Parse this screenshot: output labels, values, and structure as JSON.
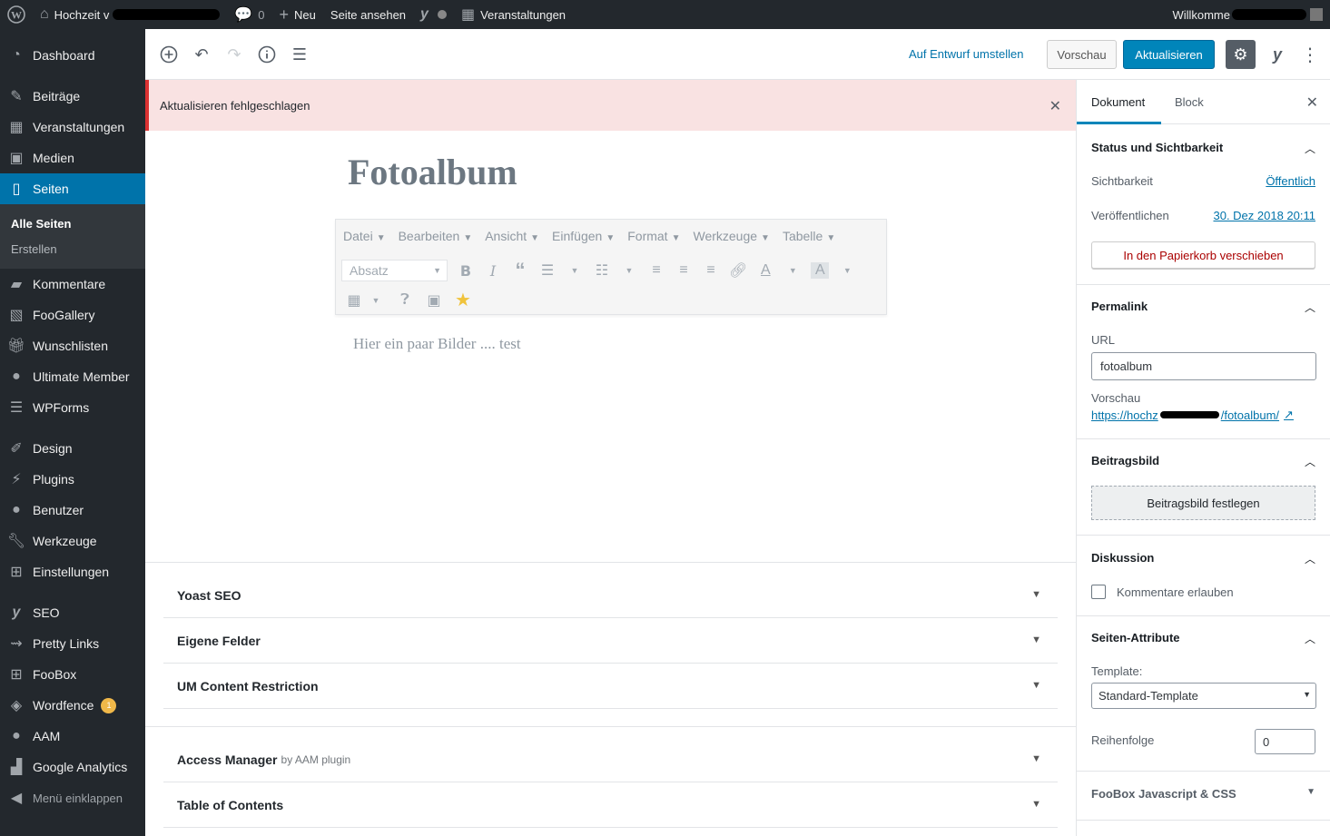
{
  "adminbar": {
    "site_name": "Hochzeit v",
    "comments_count": "0",
    "new_label": "Neu",
    "view_page": "Seite ansehen",
    "events": "Veranstaltungen",
    "greeting": "Willkomme"
  },
  "menu": {
    "items": [
      {
        "label": "Dashboard",
        "icon": "dashboard-icon"
      },
      {
        "label": "Beiträge",
        "icon": "pin-icon"
      },
      {
        "label": "Veranstaltungen",
        "icon": "calendar-icon"
      },
      {
        "label": "Medien",
        "icon": "media-icon"
      },
      {
        "label": "Seiten",
        "icon": "page-icon"
      },
      {
        "label": "Kommentare",
        "icon": "comment-icon"
      },
      {
        "label": "FooGallery",
        "icon": "gallery-icon"
      },
      {
        "label": "Wunschlisten",
        "icon": "gift-icon"
      },
      {
        "label": "Ultimate Member",
        "icon": "user-icon"
      },
      {
        "label": "WPForms",
        "icon": "form-icon"
      },
      {
        "label": "Design",
        "icon": "brush-icon"
      },
      {
        "label": "Plugins",
        "icon": "plugin-icon"
      },
      {
        "label": "Benutzer",
        "icon": "users-icon"
      },
      {
        "label": "Werkzeuge",
        "icon": "wrench-icon"
      },
      {
        "label": "Einstellungen",
        "icon": "settings-icon"
      },
      {
        "label": "SEO",
        "icon": "yoast-icon"
      },
      {
        "label": "Pretty Links",
        "icon": "link-icon"
      },
      {
        "label": "FooBox",
        "icon": "grid-icon"
      },
      {
        "label": "Wordfence",
        "icon": "shield-icon",
        "badge": "1"
      },
      {
        "label": "AAM",
        "icon": "lock-user-icon"
      },
      {
        "label": "Google Analytics",
        "icon": "chart-icon"
      }
    ],
    "submenu": [
      "Alle Seiten",
      "Erstellen"
    ],
    "collapse": "Menü einklappen"
  },
  "header": {
    "switch_draft": "Auf Entwurf umstellen",
    "preview": "Vorschau",
    "update": "Aktualisieren"
  },
  "notice": {
    "text": "Aktualisieren fehlgeschlagen"
  },
  "editor": {
    "title": "Fotoalbum",
    "menubar": [
      "Datei",
      "Bearbeiten",
      "Ansicht",
      "Einfügen",
      "Format",
      "Werkzeuge",
      "Tabelle"
    ],
    "format_select": "Absatz",
    "body": "Hier ein paar Bilder .... test"
  },
  "metaboxes": [
    {
      "title": "Yoast SEO"
    },
    {
      "title": "Eigene Felder"
    },
    {
      "title": "UM Content Restriction"
    },
    {
      "title": "Access Manager",
      "sub": "by AAM plugin"
    },
    {
      "title": "Table of Contents"
    }
  ],
  "sidebar": {
    "tab_document": "Dokument",
    "tab_block": "Block",
    "status": {
      "title": "Status und Sichtbarkeit",
      "visibility_label": "Sichtbarkeit",
      "visibility_value": "Öffentlich",
      "publish_label": "Veröffentlichen",
      "publish_value": "30. Dez 2018 20:11",
      "trash": "In den Papierkorb verschieben"
    },
    "permalink": {
      "title": "Permalink",
      "url_label": "URL",
      "url_value": "fotoalbum",
      "preview_label": "Vorschau",
      "preview_start": "https://hochz",
      "preview_end": "/fotoalbum/"
    },
    "featured": {
      "title": "Beitragsbild",
      "button": "Beitragsbild festlegen"
    },
    "discussion": {
      "title": "Diskussion",
      "allow_comments": "Kommentare erlauben"
    },
    "page_attributes": {
      "title": "Seiten-Attribute",
      "template_label": "Template:",
      "template_value": "Standard-Template",
      "order_label": "Reihenfolge",
      "order_value": "0"
    },
    "foobox": {
      "title": "FooBox Javascript & CSS"
    }
  },
  "colors": {
    "admin_dark": "#23282d",
    "accent": "#0073aa",
    "primary_button": "#0085ba",
    "notice_bg": "#f9e2e2",
    "error": "#dc3232"
  }
}
